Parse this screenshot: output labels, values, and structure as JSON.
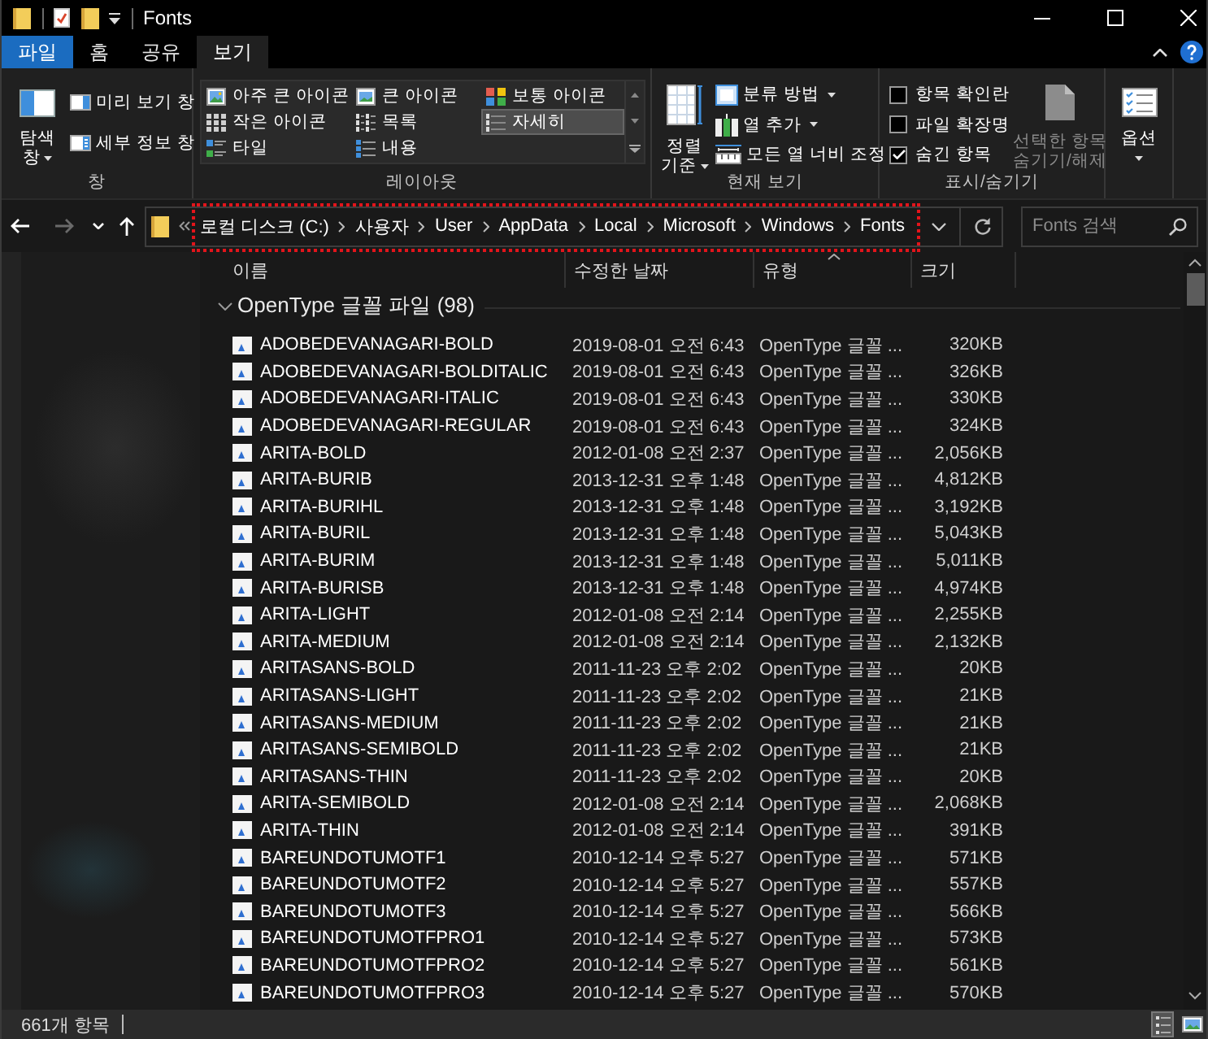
{
  "window": {
    "title": "Fonts"
  },
  "ribbon": {
    "tabs": [
      {
        "label": "파일",
        "kind": "file",
        "selected": false
      },
      {
        "label": "홈",
        "kind": "tab",
        "selected": false
      },
      {
        "label": "공유",
        "kind": "tab",
        "selected": false
      },
      {
        "label": "보기",
        "kind": "tab",
        "selected": true
      }
    ],
    "panes": {
      "caption": "창",
      "navigation": {
        "label": "탐색 창",
        "dropdown": true
      },
      "buttons": [
        {
          "kind": "preview",
          "label": "미리 보기 창"
        },
        {
          "kind": "details",
          "label": "세부 정보 창"
        }
      ]
    },
    "layout": {
      "caption": "레이아웃",
      "items": [
        {
          "kind": "extra_large",
          "label": "아주 큰 아이콘",
          "selected": false
        },
        {
          "kind": "large",
          "label": "큰 아이콘",
          "selected": false
        },
        {
          "kind": "medium",
          "label": "보통 아이콘",
          "selected": false
        },
        {
          "kind": "small",
          "label": "작은 아이콘",
          "selected": false
        },
        {
          "kind": "list",
          "label": "목록",
          "selected": false
        },
        {
          "kind": "details",
          "label": "자세히",
          "selected": true
        },
        {
          "kind": "tiles",
          "label": "타일",
          "selected": false
        },
        {
          "kind": "content",
          "label": "내용",
          "selected": false
        }
      ]
    },
    "current_view": {
      "caption": "현재 보기",
      "sort": {
        "label": "정렬 기준",
        "dropdown": true
      },
      "buttons": [
        {
          "kind": "group_by",
          "label": "분류 방법",
          "dropdown": true
        },
        {
          "kind": "add_columns",
          "label": "열 추가",
          "dropdown": true
        },
        {
          "kind": "size_columns",
          "label": "모든 열 너비 조정",
          "dropdown": false
        }
      ]
    },
    "show_hide": {
      "caption": "표시/숨기기",
      "checkboxes": [
        {
          "label": "항목 확인란",
          "checked": false
        },
        {
          "label": "파일 확장명",
          "checked": false
        },
        {
          "label": "숨긴 항목",
          "checked": true
        }
      ],
      "hide_selected": {
        "label": "선택한 항목 숨기기/해제",
        "disabled": true
      }
    },
    "options": {
      "label": "옵션",
      "dropdown": true
    }
  },
  "address_bar": {
    "nav_buttons": [
      {
        "kind": "back",
        "disabled": false
      },
      {
        "kind": "forward",
        "disabled": true
      },
      {
        "kind": "recent",
        "disabled": false
      },
      {
        "kind": "up",
        "disabled": false
      }
    ],
    "path": [
      "로컬 디스크 (C:)",
      "사용자",
      "User",
      "AppData",
      "Local",
      "Microsoft",
      "Windows",
      "Fonts"
    ],
    "search": {
      "placeholder": "Fonts 검색"
    }
  },
  "columns": [
    {
      "label": "이름",
      "sorted": false
    },
    {
      "label": "수정한 날짜",
      "sorted": false
    },
    {
      "label": "유형",
      "sorted": true
    },
    {
      "label": "크기",
      "sorted": false
    }
  ],
  "file_group": {
    "label": "OpenType 글꼴 파일 (98)",
    "expanded": true,
    "rows": [
      {
        "name": "ADOBEDEVANAGARI-BOLD",
        "modified": "2019-08-01 오전 6:43",
        "type": "OpenType 글꼴 ...",
        "size": "320KB"
      },
      {
        "name": "ADOBEDEVANAGARI-BOLDITALIC",
        "modified": "2019-08-01 오전 6:43",
        "type": "OpenType 글꼴 ...",
        "size": "326KB"
      },
      {
        "name": "ADOBEDEVANAGARI-ITALIC",
        "modified": "2019-08-01 오전 6:43",
        "type": "OpenType 글꼴 ...",
        "size": "330KB"
      },
      {
        "name": "ADOBEDEVANAGARI-REGULAR",
        "modified": "2019-08-01 오전 6:43",
        "type": "OpenType 글꼴 ...",
        "size": "324KB"
      },
      {
        "name": "ARITA-BOLD",
        "modified": "2012-01-08 오전 2:37",
        "type": "OpenType 글꼴 ...",
        "size": "2,056KB"
      },
      {
        "name": "ARITA-BURIB",
        "modified": "2013-12-31 오후 1:48",
        "type": "OpenType 글꼴 ...",
        "size": "4,812KB"
      },
      {
        "name": "ARITA-BURIHL",
        "modified": "2013-12-31 오후 1:48",
        "type": "OpenType 글꼴 ...",
        "size": "3,192KB"
      },
      {
        "name": "ARITA-BURIL",
        "modified": "2013-12-31 오후 1:48",
        "type": "OpenType 글꼴 ...",
        "size": "5,043KB"
      },
      {
        "name": "ARITA-BURIM",
        "modified": "2013-12-31 오후 1:48",
        "type": "OpenType 글꼴 ...",
        "size": "5,011KB"
      },
      {
        "name": "ARITA-BURISB",
        "modified": "2013-12-31 오후 1:48",
        "type": "OpenType 글꼴 ...",
        "size": "4,974KB"
      },
      {
        "name": "ARITA-LIGHT",
        "modified": "2012-01-08 오전 2:14",
        "type": "OpenType 글꼴 ...",
        "size": "2,255KB"
      },
      {
        "name": "ARITA-MEDIUM",
        "modified": "2012-01-08 오전 2:14",
        "type": "OpenType 글꼴 ...",
        "size": "2,132KB"
      },
      {
        "name": "ARITASANS-BOLD",
        "modified": "2011-11-23 오후 2:02",
        "type": "OpenType 글꼴 ...",
        "size": "20KB"
      },
      {
        "name": "ARITASANS-LIGHT",
        "modified": "2011-11-23 오후 2:02",
        "type": "OpenType 글꼴 ...",
        "size": "21KB"
      },
      {
        "name": "ARITASANS-MEDIUM",
        "modified": "2011-11-23 오후 2:02",
        "type": "OpenType 글꼴 ...",
        "size": "21KB"
      },
      {
        "name": "ARITASANS-SEMIBOLD",
        "modified": "2011-11-23 오후 2:02",
        "type": "OpenType 글꼴 ...",
        "size": "21KB"
      },
      {
        "name": "ARITASANS-THIN",
        "modified": "2011-11-23 오후 2:02",
        "type": "OpenType 글꼴 ...",
        "size": "20KB"
      },
      {
        "name": "ARITA-SEMIBOLD",
        "modified": "2012-01-08 오전 2:14",
        "type": "OpenType 글꼴 ...",
        "size": "2,068KB"
      },
      {
        "name": "ARITA-THIN",
        "modified": "2012-01-08 오전 2:14",
        "type": "OpenType 글꼴 ...",
        "size": "391KB"
      },
      {
        "name": "BAREUNDOTUMOTF1",
        "modified": "2010-12-14 오후 5:27",
        "type": "OpenType 글꼴 ...",
        "size": "571KB"
      },
      {
        "name": "BAREUNDOTUMOTF2",
        "modified": "2010-12-14 오후 5:27",
        "type": "OpenType 글꼴 ...",
        "size": "557KB"
      },
      {
        "name": "BAREUNDOTUMOTF3",
        "modified": "2010-12-14 오후 5:27",
        "type": "OpenType 글꼴 ...",
        "size": "566KB"
      },
      {
        "name": "BAREUNDOTUMOTFPRO1",
        "modified": "2010-12-14 오후 5:27",
        "type": "OpenType 글꼴 ...",
        "size": "573KB"
      },
      {
        "name": "BAREUNDOTUMOTFPRO2",
        "modified": "2010-12-14 오후 5:27",
        "type": "OpenType 글꼴 ...",
        "size": "561KB"
      },
      {
        "name": "BAREUNDOTUMOTFPRO3",
        "modified": "2010-12-14 오후 5:27",
        "type": "OpenType 글꼴 ...",
        "size": "570KB"
      }
    ]
  },
  "status_bar": {
    "item_count": "661개 항목",
    "views": [
      {
        "kind": "details",
        "selected": true
      },
      {
        "kind": "large_icons",
        "selected": false
      }
    ]
  }
}
